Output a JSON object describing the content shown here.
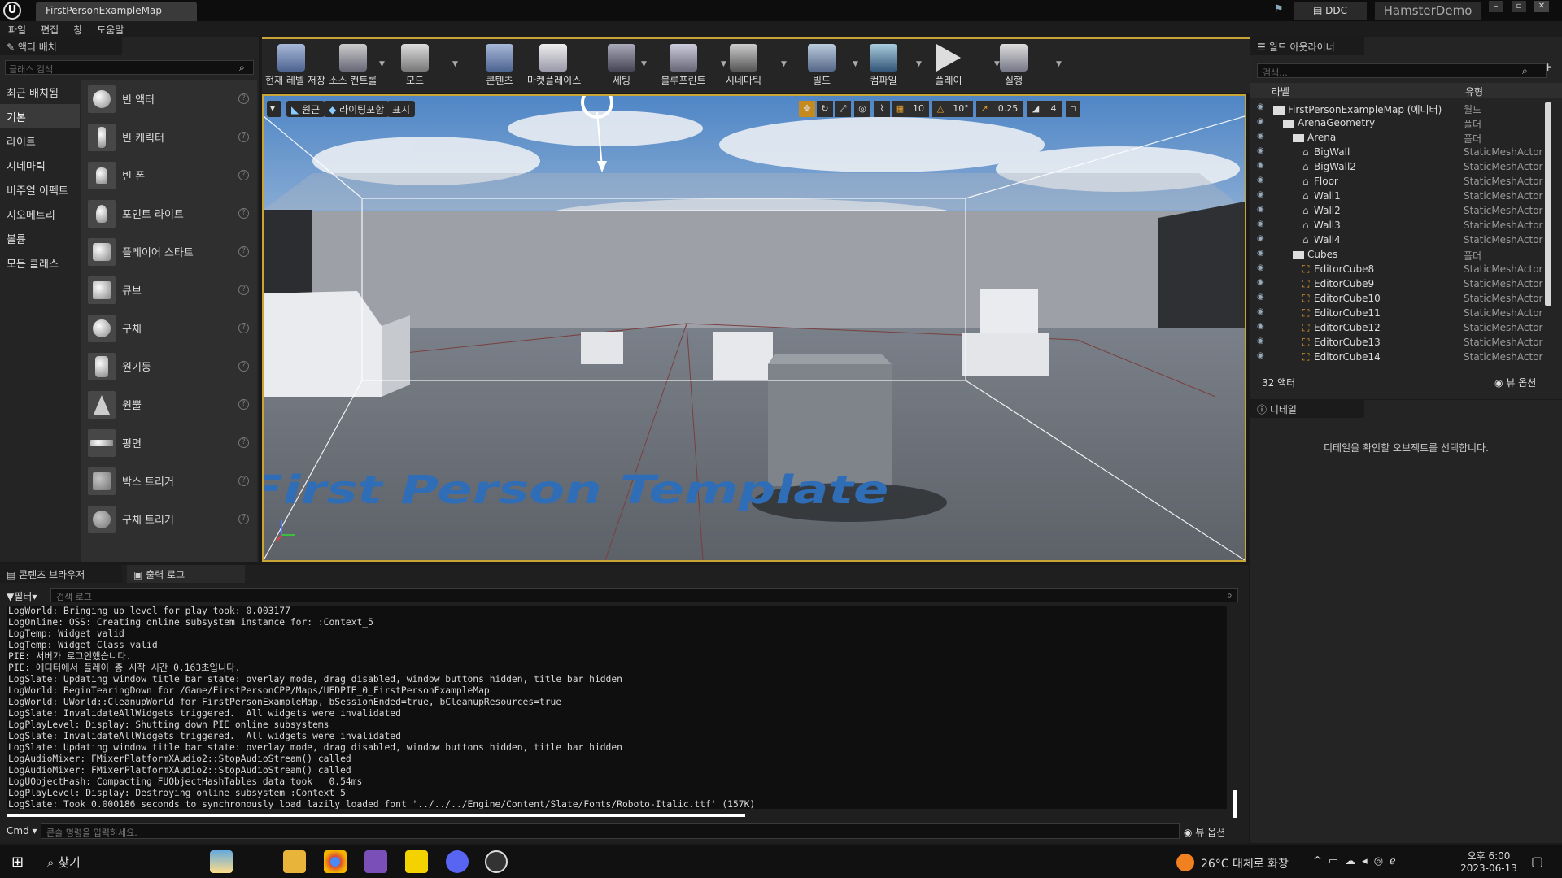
{
  "window": {
    "title": "FirstPersonExampleMap",
    "ddc": "DDC",
    "project": "HamsterDemo"
  },
  "menu": [
    "파일",
    "편집",
    "창",
    "도움말"
  ],
  "place": {
    "tab": "액터 배치",
    "search_placeholder": "클래스 검색",
    "categories": [
      "최근 배치됨",
      "기본",
      "라이트",
      "시네마틱",
      "비주얼 이펙트",
      "지오메트리",
      "볼륨",
      "모든 클래스"
    ],
    "items": [
      "빈 액터",
      "빈 캐릭터",
      "빈 폰",
      "포인트 라이트",
      "플레이어 스타트",
      "큐브",
      "구체",
      "원기둥",
      "원뿔",
      "평면",
      "박스 트리거",
      "구체 트리거"
    ]
  },
  "toolbar": [
    "현재 레벨 저장",
    "소스 컨트롤",
    "모드",
    "콘텐츠",
    "마켓플레이스",
    "세팅",
    "블루프린트",
    "시네마틱",
    "빌드",
    "컴파일",
    "플레이",
    "실행"
  ],
  "viewport": {
    "perspective": "원근",
    "lit": "라이팅포함",
    "show": "표시",
    "grid": "10",
    "rot": "10°",
    "scale": "0.25",
    "cam": "4",
    "floor_text": "First Person Template"
  },
  "outliner": {
    "tab": "월드 아웃라이너",
    "search_placeholder": "검색...",
    "col_label": "라벨",
    "col_type": "유형",
    "rows": [
      {
        "name": "FirstPersonExampleMap (에디터)",
        "type": "월드",
        "indent": 0,
        "kind": "world"
      },
      {
        "name": "ArenaGeometry",
        "type": "폴더",
        "indent": 1,
        "kind": "folder"
      },
      {
        "name": "Arena",
        "type": "폴더",
        "indent": 2,
        "kind": "folder"
      },
      {
        "name": "BigWall",
        "type": "StaticMeshActor",
        "indent": 3,
        "kind": "mesh"
      },
      {
        "name": "BigWall2",
        "type": "StaticMeshActor",
        "indent": 3,
        "kind": "mesh"
      },
      {
        "name": "Floor",
        "type": "StaticMeshActor",
        "indent": 3,
        "kind": "mesh"
      },
      {
        "name": "Wall1",
        "type": "StaticMeshActor",
        "indent": 3,
        "kind": "mesh"
      },
      {
        "name": "Wall2",
        "type": "StaticMeshActor",
        "indent": 3,
        "kind": "mesh"
      },
      {
        "name": "Wall3",
        "type": "StaticMeshActor",
        "indent": 3,
        "kind": "mesh"
      },
      {
        "name": "Wall4",
        "type": "StaticMeshActor",
        "indent": 3,
        "kind": "mesh"
      },
      {
        "name": "Cubes",
        "type": "폴더",
        "indent": 2,
        "kind": "folder"
      },
      {
        "name": "EditorCube8",
        "type": "StaticMeshActor",
        "indent": 3,
        "kind": "cube"
      },
      {
        "name": "EditorCube9",
        "type": "StaticMeshActor",
        "indent": 3,
        "kind": "cube"
      },
      {
        "name": "EditorCube10",
        "type": "StaticMeshActor",
        "indent": 3,
        "kind": "cube"
      },
      {
        "name": "EditorCube11",
        "type": "StaticMeshActor",
        "indent": 3,
        "kind": "cube"
      },
      {
        "name": "EditorCube12",
        "type": "StaticMeshActor",
        "indent": 3,
        "kind": "cube"
      },
      {
        "name": "EditorCube13",
        "type": "StaticMeshActor",
        "indent": 3,
        "kind": "cube"
      },
      {
        "name": "EditorCube14",
        "type": "StaticMeshActor",
        "indent": 3,
        "kind": "cube"
      }
    ],
    "count": "32 액터",
    "view_options": "뷰 옵션"
  },
  "details": {
    "tab": "디테일",
    "message": "디테일을 확인할 오브젝트를 선택합니다."
  },
  "bottom": {
    "tab1": "콘텐츠 브라우저",
    "tab2": "출력 로그",
    "filter": "필터",
    "search_placeholder": "검색 로그",
    "log": [
      "LogWorld: Bringing up level for play took: 0.003177",
      "LogOnline: OSS: Creating online subsystem instance for: :Context_5",
      "LogTemp: Widget valid",
      "LogTemp: Widget Class valid",
      "PIE: 서버가 로그인했습니다.",
      "PIE: 에디터에서 플레이 총 시작 시간 0.163초입니다.",
      "LogSlate: Updating window title bar state: overlay mode, drag disabled, window buttons hidden, title bar hidden",
      "LogWorld: BeginTearingDown for /Game/FirstPersonCPP/Maps/UEDPIE_0_FirstPersonExampleMap",
      "LogWorld: UWorld::CleanupWorld for FirstPersonExampleMap, bSessionEnded=true, bCleanupResources=true",
      "LogSlate: InvalidateAllWidgets triggered.  All widgets were invalidated",
      "LogPlayLevel: Display: Shutting down PIE online subsystems",
      "LogSlate: InvalidateAllWidgets triggered.  All widgets were invalidated",
      "LogSlate: Updating window title bar state: overlay mode, drag disabled, window buttons hidden, title bar hidden",
      "LogAudioMixer: FMixerPlatformXAudio2::StopAudioStream() called",
      "LogAudioMixer: FMixerPlatformXAudio2::StopAudioStream() called",
      "LogUObjectHash: Compacting FUObjectHashTables data took   0.54ms",
      "LogPlayLevel: Display: Destroying online subsystem :Context_5",
      "LogSlate: Took 0.000186 seconds to synchronously load lazily loaded font '../../../Engine/Content/Slate/Fonts/Roboto-Italic.ttf' (157K)"
    ],
    "cmd": "Cmd",
    "cmd_placeholder": "콘솔 명령을 입력하세요.",
    "view_options": "뷰 옵션"
  },
  "taskbar": {
    "search": "찾기",
    "weather": "26°C  대체로 화창",
    "time": "오후 6:00",
    "date": "2023-06-13"
  }
}
